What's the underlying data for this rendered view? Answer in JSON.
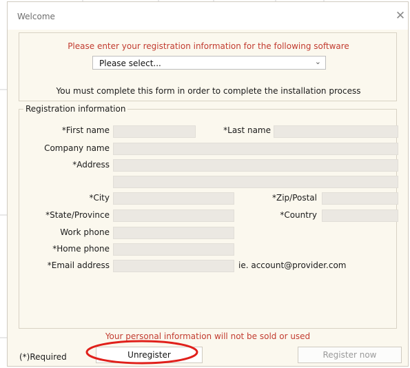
{
  "window": {
    "title": "Welcome",
    "close_icon": "close-icon"
  },
  "header": {
    "heading": "Please enter your registration information for the following software",
    "select": {
      "value": "Please select...",
      "chevron_icon": "chevron-down-icon"
    },
    "note": "You must complete this form in order to complete the installation process"
  },
  "form": {
    "legend": "Registration information",
    "labels": {
      "first_name": "*First name",
      "last_name": "*Last name",
      "company": "Company name",
      "address": "*Address",
      "city": "*City",
      "zip": "*Zip/Postal",
      "state": "*State/Province",
      "country": "*Country",
      "work_phone": "Work phone",
      "home_phone": "*Home phone",
      "email": "*Email address"
    },
    "values": {
      "first_name": "",
      "last_name": "",
      "company": "",
      "address1": "",
      "address2": "",
      "city": "",
      "zip": "",
      "state": "",
      "country": "",
      "work_phone": "",
      "home_phone": "",
      "email": ""
    },
    "email_hint": "ie. account@provider.com"
  },
  "footer": {
    "privacy_note": "Your personal information will not be sold or used",
    "required_note": "(*)Required",
    "unregister_label": "Unregister",
    "register_label": "Register now"
  },
  "colors": {
    "accent_red": "#c23b2f",
    "annotation_red": "#e0201b",
    "window_bg": "#fbf8ee",
    "input_bg": "#ebe8e2"
  }
}
